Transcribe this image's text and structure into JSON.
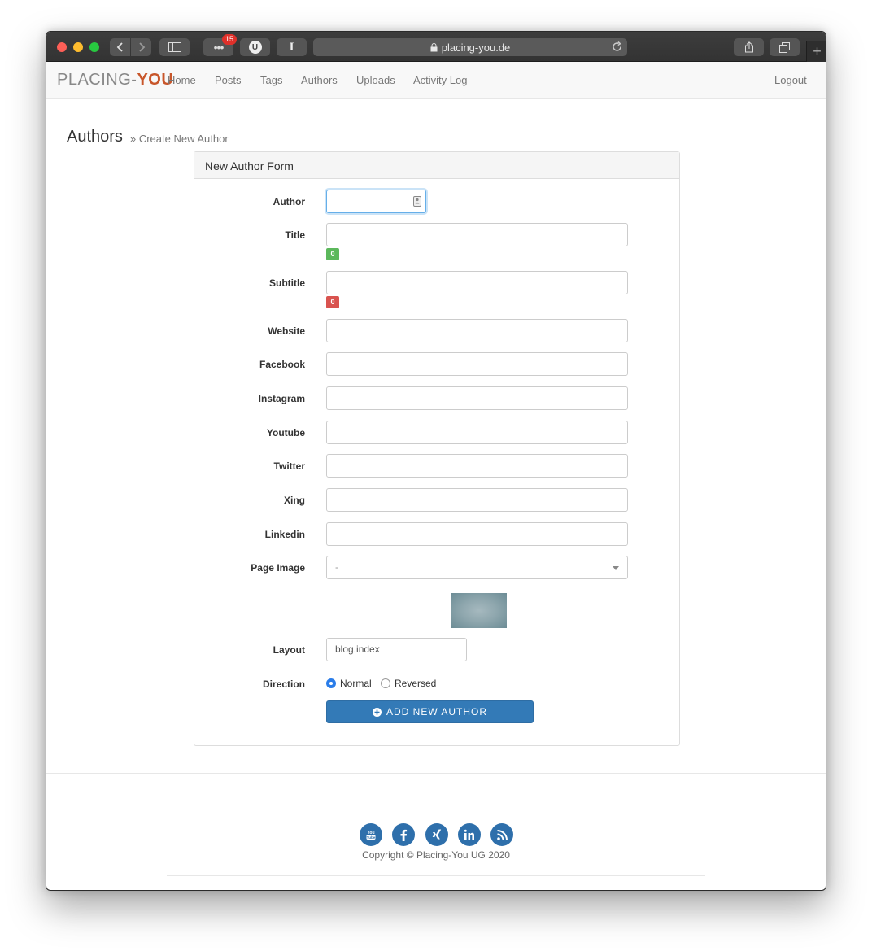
{
  "browser": {
    "url": "placing-you.de",
    "notification_count": "15",
    "ublock_label": "U",
    "cursor_label": "I",
    "new_tab": "+"
  },
  "nav": {
    "brand_left": "PLACING-",
    "brand_right": "YOU",
    "links": [
      "Home",
      "Posts",
      "Tags",
      "Authors",
      "Uploads",
      "Activity Log"
    ],
    "logout": "Logout"
  },
  "page": {
    "title": "Authors",
    "breadcrumb": "» Create New Author"
  },
  "form": {
    "heading": "New Author Form",
    "fields": {
      "author": {
        "label": "Author",
        "value": ""
      },
      "title": {
        "label": "Title",
        "value": "",
        "count": "0"
      },
      "subtitle": {
        "label": "Subtitle",
        "value": "",
        "count": "0"
      },
      "website": {
        "label": "Website",
        "value": ""
      },
      "facebook": {
        "label": "Facebook",
        "value": ""
      },
      "instagram": {
        "label": "Instagram",
        "value": ""
      },
      "youtube": {
        "label": "Youtube",
        "value": ""
      },
      "twitter": {
        "label": "Twitter",
        "value": ""
      },
      "xing": {
        "label": "Xing",
        "value": ""
      },
      "linkedin": {
        "label": "Linkedin",
        "value": ""
      },
      "page_image": {
        "label": "Page Image",
        "selected": "-"
      },
      "layout": {
        "label": "Layout",
        "value": "blog.index"
      },
      "direction": {
        "label": "Direction",
        "options": [
          "Normal",
          "Reversed"
        ],
        "selected": "Normal"
      }
    },
    "submit_label": "ADD NEW AUTHOR"
  },
  "footer": {
    "social_icons": [
      "youtube-icon",
      "facebook-icon",
      "xing-icon",
      "linkedin-icon",
      "rss-icon"
    ],
    "copyright": "Copyright © Placing-You UG 2020"
  },
  "colors": {
    "primary": "#337ab7",
    "counter_ok": "#5cb85c",
    "counter_bad": "#d9534f",
    "brand_accent": "#c8562a"
  }
}
